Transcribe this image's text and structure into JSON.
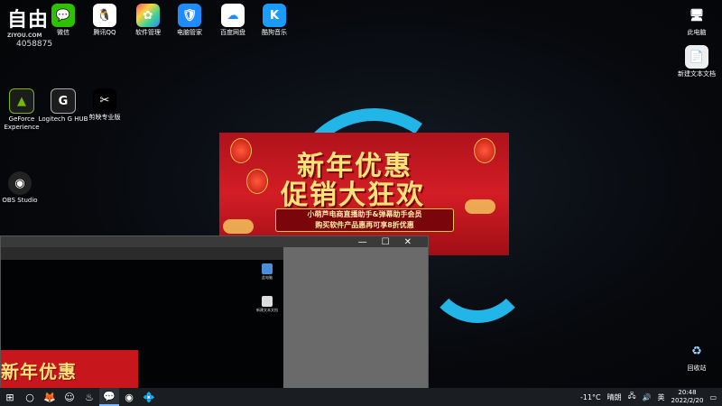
{
  "watermark": {
    "brand": "自由",
    "url": "ZIYOU.COM",
    "number": "4058875"
  },
  "desktop_icons_top": [
    {
      "label": "微信",
      "glyph": "💬",
      "color": "#2dc100",
      "icon": "wechat-icon"
    },
    {
      "label": "腾讯QQ",
      "glyph": "🐧",
      "color": "#ffffff",
      "icon": "qq-icon"
    },
    {
      "label": "软件管理",
      "glyph": "✿",
      "color": "#ffffff",
      "icon": "software-manager-icon"
    },
    {
      "label": "电脑管家",
      "glyph": "🛡",
      "color": "#1e8cff",
      "icon": "pc-manager-icon"
    },
    {
      "label": "百度网盘",
      "glyph": "☁",
      "color": "#ffffff",
      "icon": "baidu-netdisk-icon"
    },
    {
      "label": "酷狗音乐",
      "glyph": "K",
      "color": "#1a9cff",
      "icon": "kugou-music-icon"
    }
  ],
  "desktop_icons_left": [
    {
      "label": "GeForce Experience",
      "glyph": "▲",
      "color": "#1c1c1c",
      "icon": "geforce-icon"
    },
    {
      "label": "Logitech G HUB",
      "glyph": "G",
      "color": "#1c1c1c",
      "icon": "logitech-ghub-icon"
    },
    {
      "label": "剪映专业版",
      "glyph": "✂",
      "color": "#000000",
      "icon": "jianying-icon"
    },
    {
      "label": "OBS Studio",
      "glyph": "◉",
      "color": "#222222",
      "icon": "obs-icon"
    }
  ],
  "desktop_icons_right": [
    {
      "label": "此电脑",
      "glyph": "🖥",
      "icon": "this-pc-icon"
    },
    {
      "label": "新建文本文档",
      "glyph": "📄",
      "icon": "text-document-icon"
    },
    {
      "label": "回收站",
      "glyph": "♻",
      "icon": "recycle-bin-icon"
    }
  ],
  "banner": {
    "title_line1": "新年优惠",
    "title_line2": "促销大狂欢",
    "note_line1": "小萌芦电商直播助手&弹幕助手会员",
    "note_line2": "购买软件产品惠再可享8折优惠",
    "bg_color": "#c8161d",
    "title_color": "#ffe37a"
  },
  "window": {
    "minimize": "—",
    "maximize": "☐",
    "close": "✕"
  },
  "inner_screen": {
    "icons": [
      {
        "label": "此电脑"
      },
      {
        "label": "新建文本文档"
      }
    ],
    "banner_title": "新年优惠"
  },
  "taskbar": {
    "start": "⊞",
    "search": "○",
    "apps": [
      "🦊",
      "☺",
      "♨",
      "💬",
      "◉",
      "💠"
    ],
    "weather_temp": "-11°C",
    "weather_text": "晴朗",
    "lang": "英",
    "time": "20:48",
    "date": "2022/2/20"
  }
}
